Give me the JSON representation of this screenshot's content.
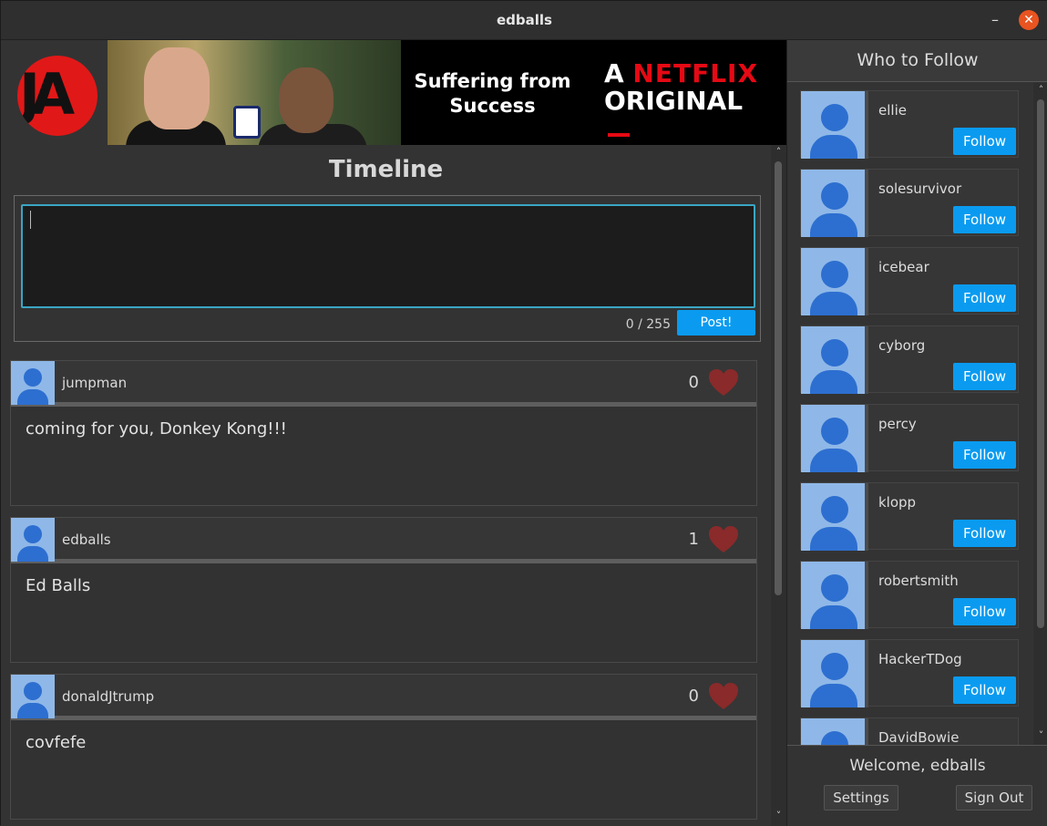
{
  "window": {
    "title": "edballs",
    "minimize_glyph": "–",
    "close_glyph": "✕"
  },
  "banner": {
    "logo_text": "JA",
    "ad": {
      "tagline": "Suffering from Success",
      "netflix_prefix": "A",
      "netflix_word": "NETFLIX",
      "netflix_suffix": "ORIGINAL"
    }
  },
  "timeline": {
    "title": "Timeline",
    "composer": {
      "value": "",
      "counter": "0 / 255",
      "post_label": "Post!"
    },
    "posts": [
      {
        "user": "jumpman",
        "likes": "0",
        "text": "coming for you, Donkey Kong!!!"
      },
      {
        "user": "edballs",
        "likes": "1",
        "text": "Ed Balls"
      },
      {
        "user": "donaldJtrump",
        "likes": "0",
        "text": "covfefe"
      }
    ]
  },
  "who_to_follow": {
    "title": "Who to Follow",
    "follow_label": "Follow",
    "users": [
      "ellie",
      "solesurvivor",
      "icebear",
      "cyborg",
      "percy",
      "klopp",
      "robertsmith",
      "HackerTDog",
      "DavidBowie"
    ]
  },
  "footer": {
    "welcome": "Welcome, edballs",
    "settings_label": "Settings",
    "signout_label": "Sign Out"
  },
  "colors": {
    "accent": "#0a9bf0",
    "heart": "#8a2a2a",
    "netflix_red": "#e50914",
    "logo_red": "#e11818"
  },
  "icons": {
    "like": "heart-icon",
    "avatar": "user-avatar-icon",
    "scroll_up": "chevron-up-icon",
    "scroll_down": "chevron-down-icon"
  }
}
